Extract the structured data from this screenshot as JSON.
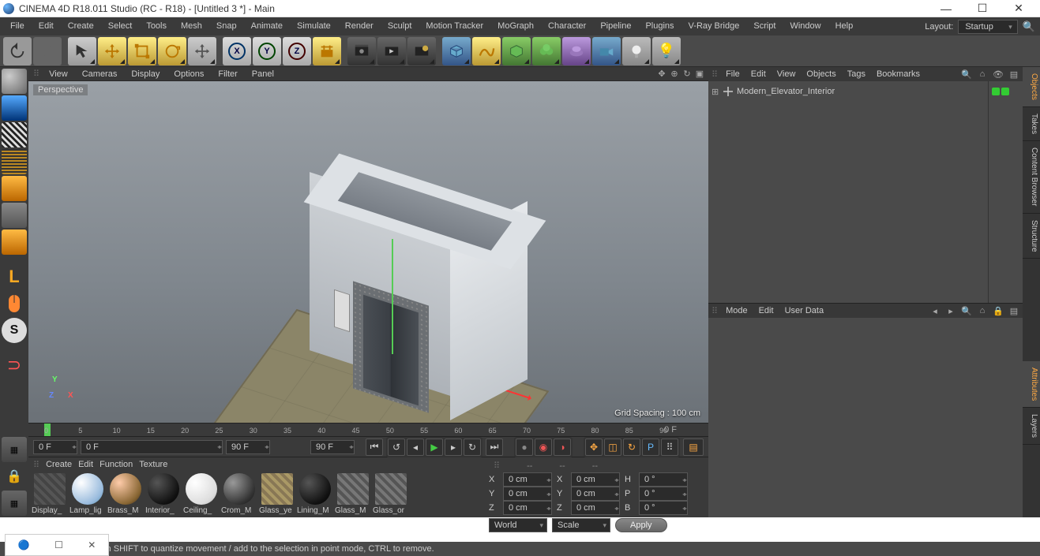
{
  "window": {
    "title": "CINEMA 4D R18.011 Studio (RC - R18) - [Untitled 3 *] - Main"
  },
  "menu": {
    "items": [
      "File",
      "Edit",
      "Create",
      "Select",
      "Tools",
      "Mesh",
      "Snap",
      "Animate",
      "Simulate",
      "Render",
      "Sculpt",
      "Motion Tracker",
      "MoGraph",
      "Character",
      "Pipeline",
      "Plugins",
      "V-Ray Bridge",
      "Script",
      "Window",
      "Help"
    ],
    "layout_label": "Layout:",
    "layout_value": "Startup"
  },
  "viewport": {
    "menu": [
      "View",
      "Cameras",
      "Display",
      "Options",
      "Filter",
      "Panel"
    ],
    "label": "Perspective",
    "grid_spacing": "Grid Spacing : 100 cm"
  },
  "timeline": {
    "ticks": [
      "0",
      "5",
      "10",
      "15",
      "20",
      "25",
      "30",
      "35",
      "40",
      "45",
      "50",
      "55",
      "60",
      "65",
      "70",
      "75",
      "80",
      "85",
      "90"
    ],
    "end_label": "0 F",
    "field_start": "0 F",
    "field_in": "0 F",
    "field_out": "90 F",
    "field_end": "90 F"
  },
  "materials": {
    "menu": [
      "Create",
      "Edit",
      "Function",
      "Texture"
    ],
    "items": [
      {
        "name": "Display_",
        "type": "flat",
        "bg": "repeating-linear-gradient(45deg,#555,#555 4px,#444 4px,#444 8px)",
        "overlay": "#f33"
      },
      {
        "name": "Lamp_lig",
        "bg": "radial-gradient(circle at 30% 30%,#fff,#9bd 70%,#48a)"
      },
      {
        "name": "Brass_M",
        "bg": "radial-gradient(circle at 30% 30%,#fca,#863 70%,#321)"
      },
      {
        "name": "Interior_",
        "bg": "radial-gradient(circle at 30% 30%,#555,#111 70%,#000)"
      },
      {
        "name": "Ceiling_",
        "bg": "radial-gradient(circle at 30% 30%,#fff,#ddd 70%,#aaa)"
      },
      {
        "name": "Crom_M",
        "bg": "radial-gradient(circle at 30% 30%,#999,#333 70%,#111)"
      },
      {
        "name": "Glass_ye",
        "type": "flat",
        "bg": "repeating-linear-gradient(45deg,#a96,#a96 4px,#875 4px,#875 8px)"
      },
      {
        "name": "Lining_M",
        "bg": "radial-gradient(circle at 30% 30%,#555,#111 70%,#000)"
      },
      {
        "name": "Glass_M",
        "type": "flat",
        "bg": "repeating-linear-gradient(45deg,#777,#777 4px,#555 4px,#555 8px)"
      },
      {
        "name": "Glass_or",
        "type": "flat",
        "bg": "repeating-linear-gradient(45deg,#777,#777 4px,#555 4px,#555 8px)"
      }
    ]
  },
  "coord": {
    "header": [
      "--",
      "--",
      "--"
    ],
    "rows": [
      {
        "axis": "X",
        "pos": "0 cm",
        "size": "0 cm",
        "rlab": "H",
        "rot": "0 °"
      },
      {
        "axis": "Y",
        "pos": "0 cm",
        "size": "0 cm",
        "rlab": "P",
        "rot": "0 °"
      },
      {
        "axis": "Z",
        "pos": "0 cm",
        "size": "0 cm",
        "rlab": "B",
        "rot": "0 °"
      }
    ],
    "drop1": "World",
    "drop2": "Scale",
    "apply": "Apply"
  },
  "obj_manager": {
    "menu": [
      "File",
      "Edit",
      "View",
      "Objects",
      "Tags",
      "Bookmarks"
    ],
    "root": {
      "name": "Modern_Elevator_Interior"
    }
  },
  "attr_manager": {
    "menu": [
      "Mode",
      "Edit",
      "User Data"
    ]
  },
  "vtabs": [
    "Objects",
    "Takes",
    "Content Browser",
    "Structure",
    "Attributes",
    "Layers"
  ],
  "status": {
    "text": "move elements. Hold down SHIFT to quantize movement / add to the selection in point mode, CTRL to remove."
  }
}
